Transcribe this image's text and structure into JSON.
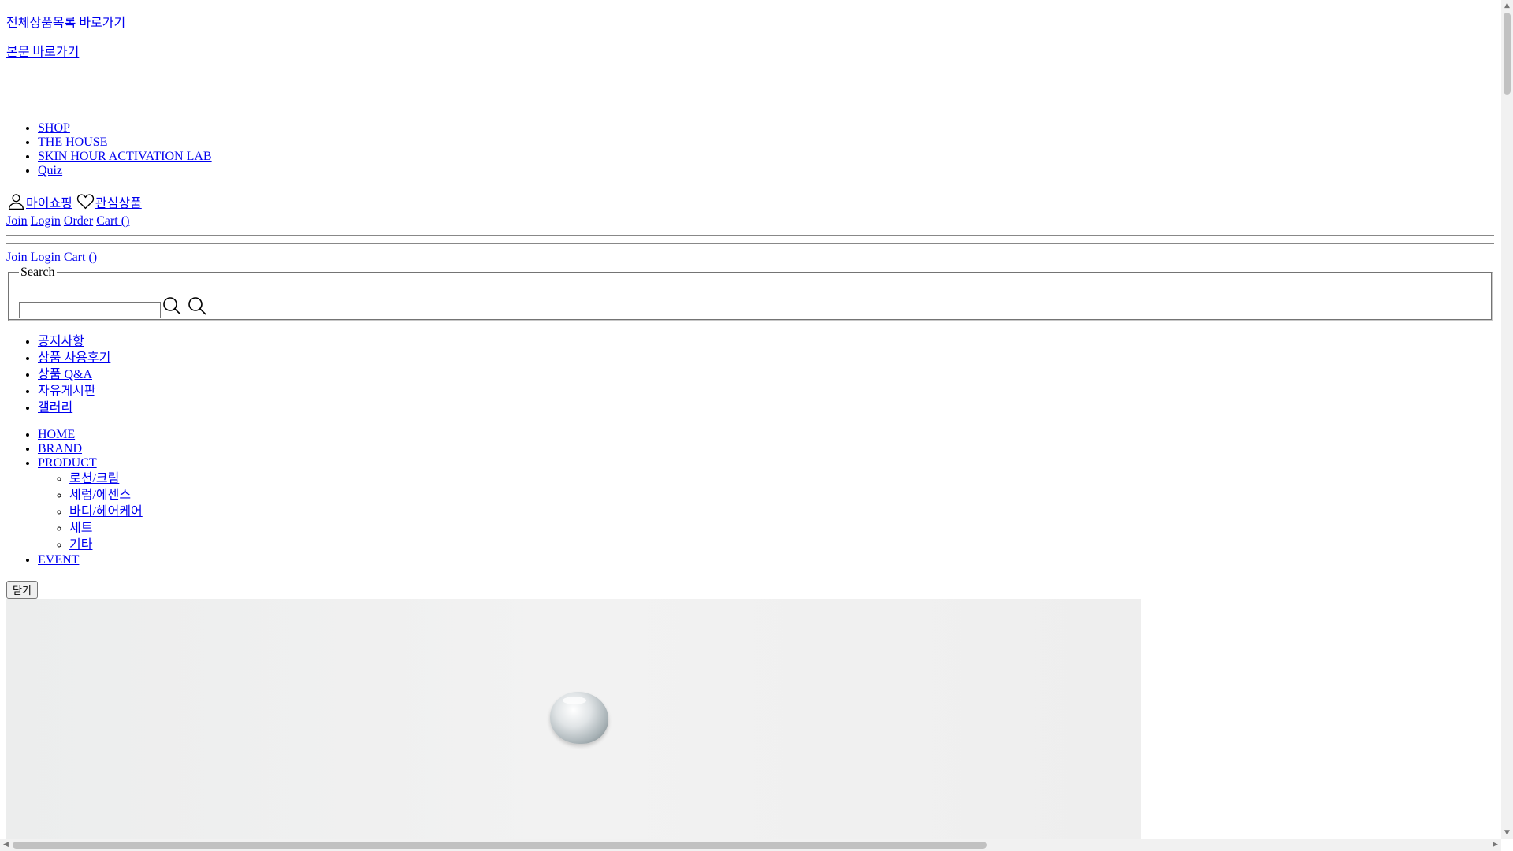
{
  "skip_links": {
    "all_products": "전체상품목록 바로가기",
    "main_content": "본문 바로가기"
  },
  "top_nav": [
    "SHOP",
    "THE HOUSE",
    "SKIN HOUR ACTIVATION LAB",
    "Quiz"
  ],
  "my_links": {
    "myshop": "마이쇼핑",
    "wishlist": "관심상품",
    "myshop_icon": "user-icon",
    "wishlist_icon": "heart-icon"
  },
  "auth_links_1": [
    "Join",
    "Login",
    "Order",
    "Cart ()"
  ],
  "auth_links_2": [
    "Join",
    "Login",
    "Cart ()"
  ],
  "search": {
    "legend": "Search",
    "value": "",
    "icon": "search-icon"
  },
  "board_links": [
    "공지사항",
    "상품 사용후기",
    "상품 Q&A",
    "자유게시판",
    "갤러리"
  ],
  "category_nav": {
    "home": "HOME",
    "brand": "BRAND",
    "product": "PRODUCT",
    "product_sub": [
      "로션/크림",
      "세럼/에센스",
      "바디/헤어케어",
      "세트",
      "기타"
    ],
    "event": "EVENT"
  },
  "close_button": "닫기",
  "colors": {
    "link": "#0000ee",
    "banner_bg": "#eeefef"
  }
}
